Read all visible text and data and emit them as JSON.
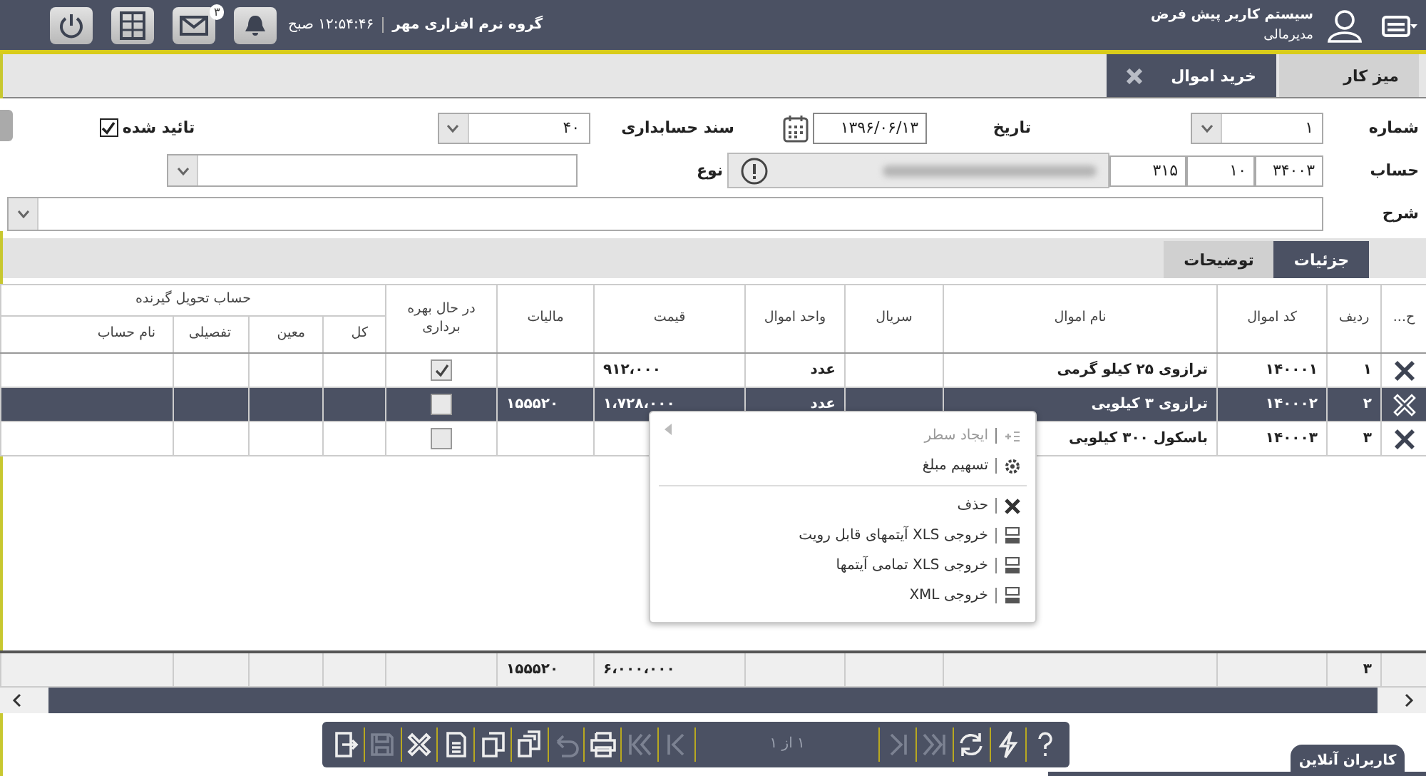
{
  "header": {
    "user_name": "سیستم کاربر پیش فرض",
    "user_role": "مدیرمالی",
    "company": "گروه نرم افزاری مهر",
    "time": "۱۲:۵۴:۴۶ صبح",
    "mail_badge": "۳"
  },
  "tabs": [
    {
      "label": "میز کار",
      "selected": false,
      "closable": false
    },
    {
      "label": "خرید اموال",
      "selected": true,
      "closable": true
    }
  ],
  "form": {
    "number": {
      "label": "شماره",
      "value": "۱"
    },
    "date": {
      "label": "تاریخ",
      "value": "۱۳۹۶/۰۶/۱۳"
    },
    "voucher": {
      "label": "سند حسابداری",
      "value": "۴۰"
    },
    "approved": {
      "label": "تائید شده",
      "checked": true
    },
    "account": {
      "label": "حساب",
      "parts": [
        "۳۴۰۰۳",
        "۱۰",
        "۳۱۵"
      ]
    },
    "type": {
      "label": "نوع"
    },
    "description": {
      "label": "شرح"
    }
  },
  "sub_tabs": [
    {
      "label": "جزئیات",
      "selected": true
    },
    {
      "label": "توضیحات",
      "selected": false
    }
  ],
  "table": {
    "columns": [
      "ح...",
      "ردیف",
      "کد اموال",
      "نام اموال",
      "سریال",
      "واحد اموال",
      "قیمت",
      "مالیات",
      "در حال بهره برداری"
    ],
    "group": {
      "label": "حساب تحویل گیرنده",
      "columns": [
        "کل",
        "معین",
        "تفصیلی",
        "نام حساب"
      ]
    },
    "rows": [
      {
        "row": "۱",
        "code": "۱۴۰۰۰۱",
        "name": "ترازوی ۲۵ کیلو گرمی",
        "unit": "عدد",
        "price": "۹۱۲،۰۰۰",
        "in_use": true,
        "selected": false
      },
      {
        "row": "۲",
        "code": "۱۴۰۰۰۲",
        "name": "ترازوی ۳ کیلویی",
        "unit": "عدد",
        "price": "۱،۷۲۸،۰۰۰",
        "tax": "۱۵۵۵۲۰",
        "in_use": false,
        "selected": true
      },
      {
        "row": "۳",
        "code": "۱۴۰۰۰۳",
        "name": "باسکول ۳۰۰ کیلویی",
        "in_use": false,
        "selected": false
      }
    ],
    "totals": {
      "row": "۳",
      "price": "۶،۰۰۰،۰۰۰",
      "tax": "۱۵۵۵۲۰"
    }
  },
  "context_menu": [
    {
      "kind": "add",
      "label": "ایجاد سطر",
      "disabled": true
    },
    {
      "kind": "split",
      "label": "تسهیم مبلغ",
      "disabled": false
    },
    {
      "kind": "separator"
    },
    {
      "kind": "delete",
      "label": "حذف",
      "disabled": false
    },
    {
      "kind": "xls",
      "label": "خروجی XLS آیتمهای قابل رویت",
      "disabled": false
    },
    {
      "kind": "xls_all",
      "label": "خروجی XLS تمامی آیتمها",
      "disabled": false
    },
    {
      "kind": "xml",
      "label": "خروجی XML",
      "disabled": false
    }
  ],
  "toolbar": [
    {
      "kind": "exit",
      "disabled": false
    },
    {
      "kind": "save",
      "disabled": true
    },
    {
      "kind": "delete",
      "disabled": false
    },
    {
      "kind": "document",
      "disabled": false
    },
    {
      "kind": "copy",
      "disabled": false
    },
    {
      "kind": "copy_all",
      "disabled": false
    },
    {
      "kind": "undo",
      "disabled": true
    },
    {
      "kind": "print",
      "disabled": false
    },
    {
      "kind": "first",
      "disabled": true
    },
    {
      "kind": "prev",
      "disabled": true
    },
    {
      "kind": "pager",
      "text": "۱ از ۱"
    },
    {
      "kind": "next",
      "disabled": true
    },
    {
      "kind": "last",
      "disabled": true
    },
    {
      "kind": "refresh",
      "disabled": false
    },
    {
      "kind": "bolt",
      "disabled": false
    },
    {
      "kind": "help",
      "disabled": false
    }
  ],
  "online_users": {
    "label": "کاربران آنلاین"
  }
}
